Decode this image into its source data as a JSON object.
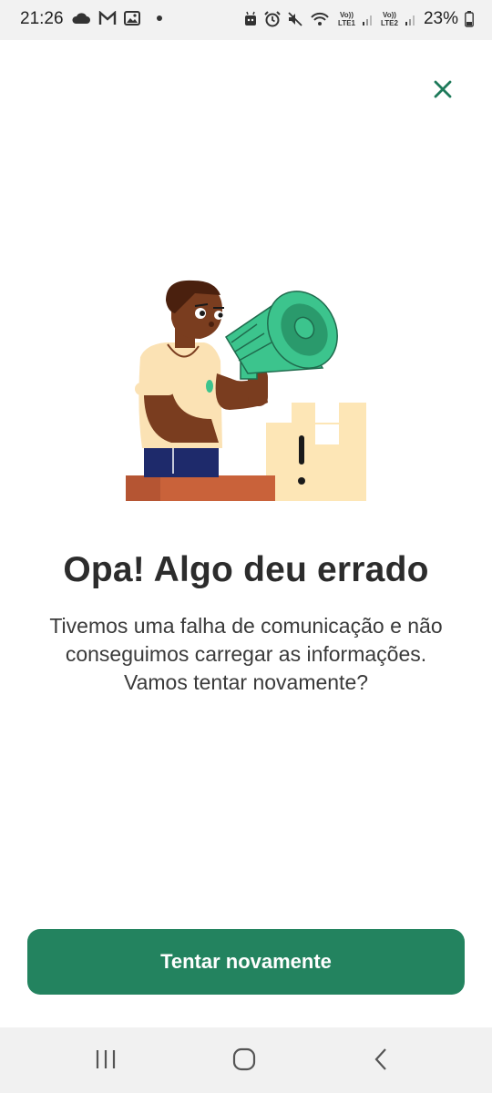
{
  "status_bar": {
    "time": "21:26",
    "battery": "23%",
    "icons_left": [
      "cloud-icon",
      "gmail-icon",
      "gallery-icon",
      "dot-icon"
    ],
    "icons_right": [
      "android-icon",
      "alarm-icon",
      "mute-icon",
      "wifi-calling-icon",
      "signal-lte1-icon",
      "signal-lte2-icon",
      "battery-icon"
    ],
    "lte1": "LTE1",
    "lte2": "LTE2",
    "volte": "Vo))"
  },
  "close_icon": "close-icon",
  "illustration": "person-with-megaphone-illustration",
  "colors": {
    "accent": "#23835f",
    "close": "#1e7a5a",
    "megaphone": "#3cc48d",
    "skin": "#7a3d1f",
    "shirt": "#fbe2b4",
    "pants": "#1e2a6b",
    "table": "#c9623a",
    "box": "#fde6b6"
  },
  "main": {
    "title": "Opa! Algo deu errado",
    "message_line1": "Tivemos uma falha de comunicação e não",
    "message_line2": "conseguimos carregar as informações.",
    "message_line3": "Vamos tentar novamente?"
  },
  "retry_button": {
    "label": "Tentar novamente"
  },
  "nav_bar": {
    "icons": [
      "recent-apps-icon",
      "home-icon",
      "back-icon"
    ]
  }
}
